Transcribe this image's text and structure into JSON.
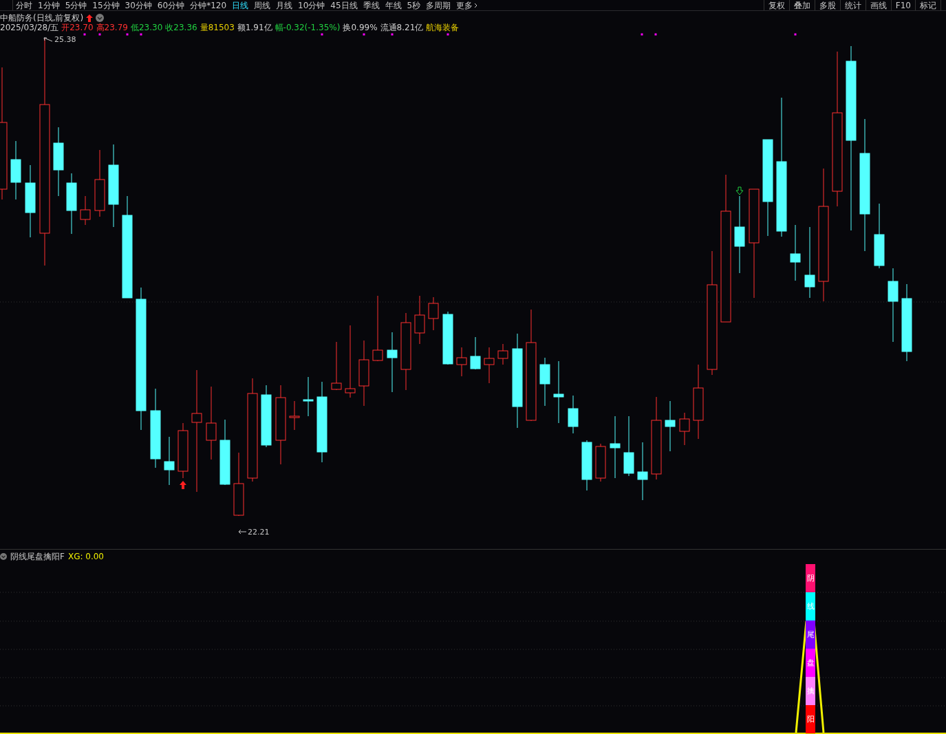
{
  "toolbar": {
    "tabs": [
      {
        "label": "分时",
        "selected": false
      },
      {
        "label": "1分钟",
        "selected": false
      },
      {
        "label": "5分钟",
        "selected": false
      },
      {
        "label": "15分钟",
        "selected": false
      },
      {
        "label": "30分钟",
        "selected": false
      },
      {
        "label": "60分钟",
        "selected": false
      },
      {
        "label": "分钟*120",
        "selected": false
      },
      {
        "label": "日线",
        "selected": true
      },
      {
        "label": "周线",
        "selected": false
      },
      {
        "label": "月线",
        "selected": false
      },
      {
        "label": "10分钟",
        "selected": false
      },
      {
        "label": "45日线",
        "selected": false
      },
      {
        "label": "季线",
        "selected": false
      },
      {
        "label": "年线",
        "selected": false
      },
      {
        "label": "5秒",
        "selected": false
      },
      {
        "label": "多周期",
        "selected": false
      },
      {
        "label": "更多",
        "selected": false
      }
    ],
    "buttons": [
      "复权",
      "叠加",
      "多股",
      "统计",
      "画线",
      "F10",
      "标记"
    ]
  },
  "stock": {
    "title": "中船防务(日线,前复权)",
    "date": "2025/03/28/五",
    "fields": [
      {
        "text": "开23.70",
        "kind": "up"
      },
      {
        "text": "高23.79",
        "kind": "up"
      },
      {
        "text": "低23.30",
        "kind": "down"
      },
      {
        "text": "收23.36",
        "kind": "down"
      },
      {
        "text": "量81503",
        "kind": "volume"
      },
      {
        "text": "额1.91亿",
        "kind": "plain"
      },
      {
        "text": "幅-0.32(-1.35%)",
        "kind": "down"
      },
      {
        "text": "换0.99%",
        "kind": "plain"
      },
      {
        "text": "流通8.21亿",
        "kind": "plain"
      },
      {
        "text": "航海装备",
        "kind": "volume"
      }
    ]
  },
  "price_chart": {
    "high_label": "25.38",
    "low_label": "22.21"
  },
  "indicator": {
    "name": "阴线尾盘擒阳F",
    "value": "XG: 0.00",
    "column": [
      {
        "char": "阴",
        "color": "#ff1070"
      },
      {
        "char": "线",
        "color": "#00ffff"
      },
      {
        "char": "尾",
        "color": "#8000ff"
      },
      {
        "char": "盘",
        "color": "#ff00ff"
      },
      {
        "char": "擒",
        "color": "#ff80ff"
      },
      {
        "char": "阳",
        "color": "#ff0000"
      }
    ]
  }
}
